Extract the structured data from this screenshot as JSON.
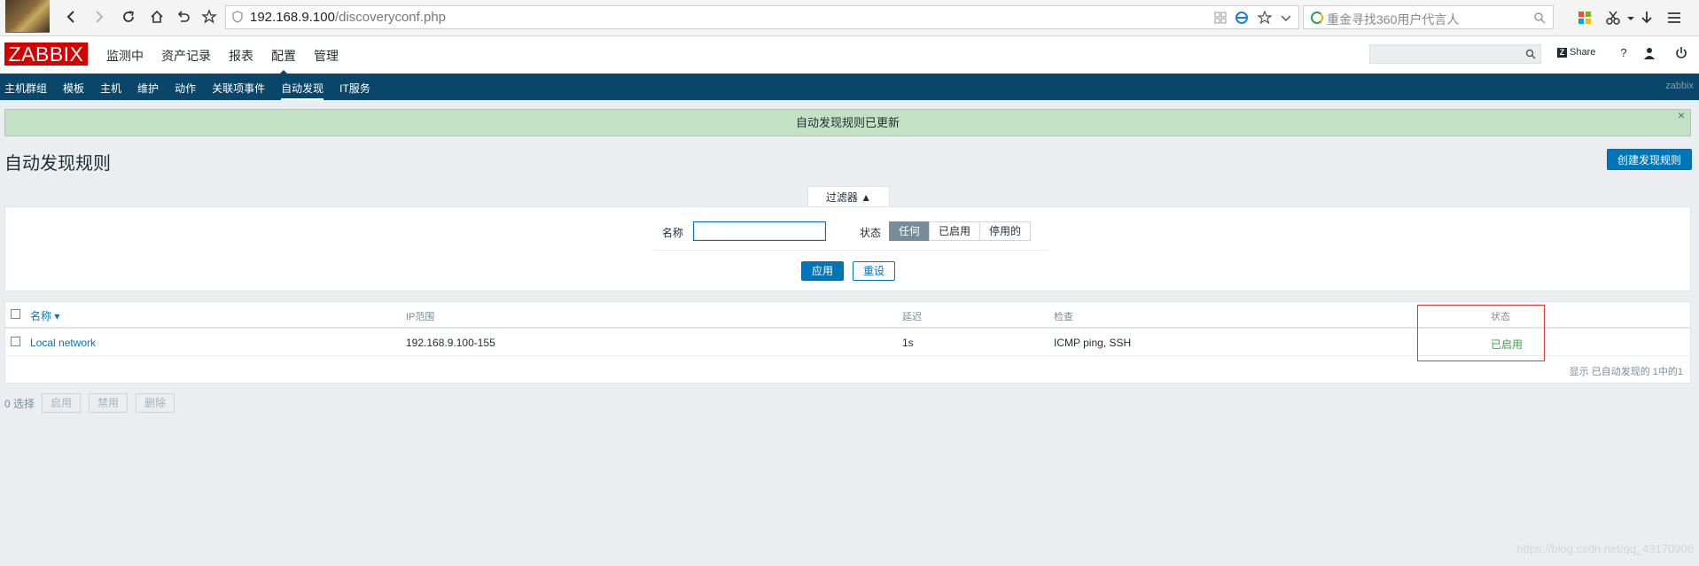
{
  "browser": {
    "url_host": "192.168.9.100",
    "url_path": "/discoveryconf.php",
    "search_placeholder": "重金寻找360用户代言人"
  },
  "header": {
    "logo": "ZABBIX",
    "menu": [
      {
        "label": "监测中"
      },
      {
        "label": "资产记录"
      },
      {
        "label": "报表"
      },
      {
        "label": "配置"
      },
      {
        "label": "管理"
      }
    ],
    "share_label": "Share",
    "help_label": "?"
  },
  "subnav": {
    "items": [
      {
        "label": "主机群组"
      },
      {
        "label": "模板"
      },
      {
        "label": "主机"
      },
      {
        "label": "维护"
      },
      {
        "label": "动作"
      },
      {
        "label": "关联项事件"
      },
      {
        "label": "自动发现"
      },
      {
        "label": "IT服务"
      }
    ],
    "user": "zabbix"
  },
  "message": {
    "text": "自动发现规则已更新",
    "close": "×"
  },
  "page": {
    "title": "自动发现规则",
    "create_button": "创建发现规则"
  },
  "filter": {
    "tab_label": "过滤器 ▲",
    "name_label": "名称",
    "name_value": "",
    "status_label": "状态",
    "status_options": [
      {
        "label": "任何"
      },
      {
        "label": "已启用"
      },
      {
        "label": "停用的"
      }
    ],
    "apply": "应用",
    "reset": "重设"
  },
  "table": {
    "headers": {
      "name": "名称 ▾",
      "ip_range": "IP范围",
      "delay": "延迟",
      "checks": "检查",
      "status": "状态"
    },
    "rows": [
      {
        "name": "Local network",
        "ip_range": "192.168.9.100-155",
        "delay": "1s",
        "checks": "ICMP ping, SSH",
        "status": "已启用"
      }
    ],
    "footer": "显示 已自动发现的 1中的1"
  },
  "mass_actions": {
    "selected": "0 选择",
    "enable": "启用",
    "disable": "禁用",
    "delete": "删除"
  },
  "watermark": "https://blog.csdn.net/qq_43170906",
  "colors": {
    "brand": "#d40000",
    "nav": "#0a466a",
    "accent": "#0275b8",
    "success_bg": "#c2e1c5",
    "enabled": "#429e47",
    "highlight": "#e03838"
  }
}
